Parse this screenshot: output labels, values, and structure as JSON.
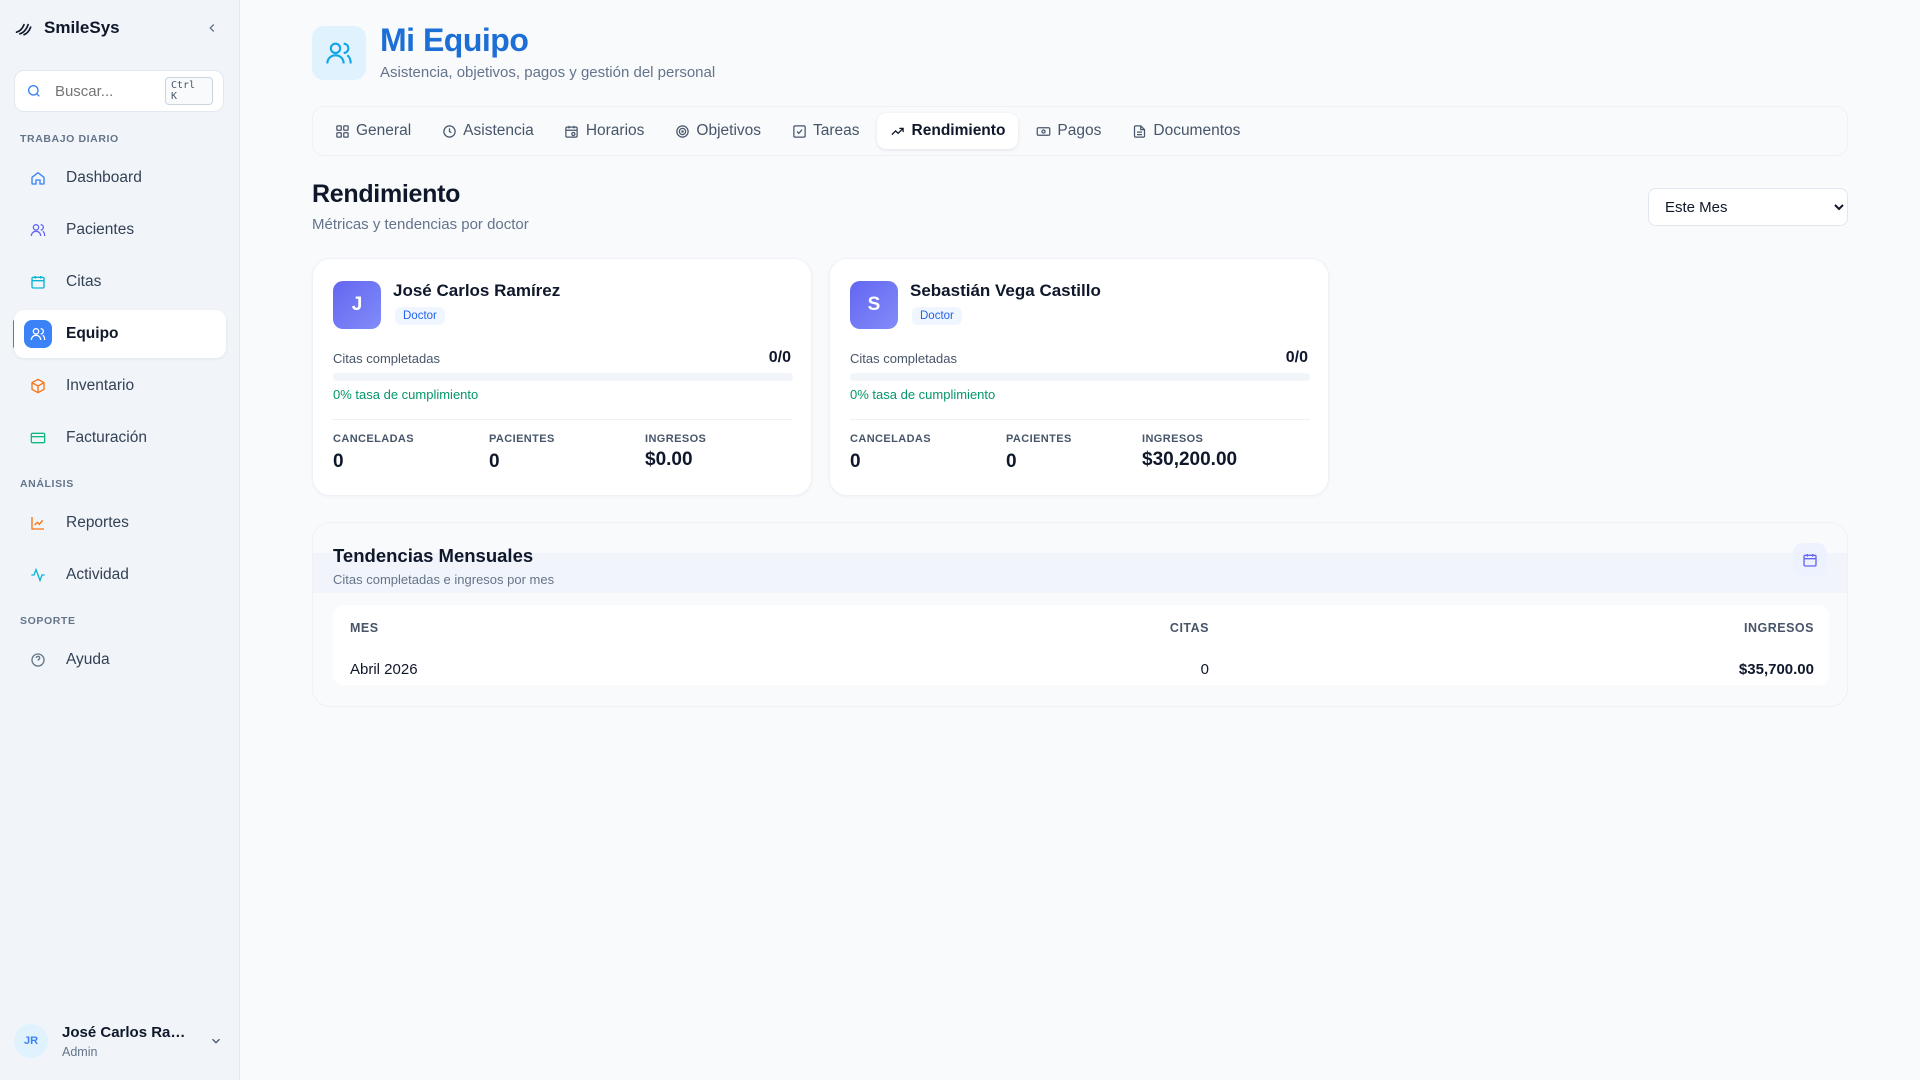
{
  "app": {
    "name": "SmileSys"
  },
  "search": {
    "placeholder": "Buscar...",
    "shortcut": "Ctrl K"
  },
  "sidebar": {
    "sections": [
      {
        "title": "Trabajo diario"
      },
      {
        "title": "Análisis"
      },
      {
        "title": "Soporte"
      }
    ],
    "items": [
      {
        "label": "Dashboard",
        "icon": "home-icon",
        "color": "#3b82f6"
      },
      {
        "label": "Pacientes",
        "icon": "users-icon",
        "color": "#6366f1"
      },
      {
        "label": "Citas",
        "icon": "calendar-icon",
        "color": "#06b6d4"
      },
      {
        "label": "Equipo",
        "icon": "team-icon",
        "color": "#3b82f6",
        "active": true
      },
      {
        "label": "Inventario",
        "icon": "package-icon",
        "color": "#f97316"
      },
      {
        "label": "Facturación",
        "icon": "credit-card-icon",
        "color": "#10b981"
      },
      {
        "label": "Reportes",
        "icon": "chart-line-icon",
        "color": "#f97316"
      },
      {
        "label": "Actividad",
        "icon": "activity-icon",
        "color": "#06b6d4"
      },
      {
        "label": "Ayuda",
        "icon": "help-circle-icon",
        "color": "#64748b"
      }
    ]
  },
  "user": {
    "initials": "JR",
    "name": "José Carlos Ramír...",
    "role": "Admin"
  },
  "header": {
    "title": "Mi Equipo",
    "subtitle": "Asistencia, objetivos, pagos y gestión del personal"
  },
  "tabs": [
    {
      "label": "General",
      "icon": "grid-icon"
    },
    {
      "label": "Asistencia",
      "icon": "clock-icon"
    },
    {
      "label": "Horarios",
      "icon": "calendar-clock-icon"
    },
    {
      "label": "Objetivos",
      "icon": "target-icon"
    },
    {
      "label": "Tareas",
      "icon": "check-square-icon"
    },
    {
      "label": "Rendimiento",
      "icon": "trending-up-icon",
      "active": true
    },
    {
      "label": "Pagos",
      "icon": "banknote-icon"
    },
    {
      "label": "Documentos",
      "icon": "file-text-icon"
    }
  ],
  "performance": {
    "title": "Rendimiento",
    "subtitle": "Métricas y tendencias por doctor",
    "period": {
      "selected": "Este Mes"
    }
  },
  "doctors": [
    {
      "initial": "J",
      "name": "José Carlos Ramírez",
      "role": "Doctor",
      "completed_label": "Citas completadas",
      "completed": "0/0",
      "completion_fraction": 0,
      "rate": "0% tasa de cumplimiento",
      "canceled_label": "Canceladas",
      "canceled": "0",
      "patients_label": "Pacientes",
      "patients": "0",
      "revenue_label": "Ingresos",
      "revenue": "$0.00"
    },
    {
      "initial": "S",
      "name": "Sebastián Vega Castillo",
      "role": "Doctor",
      "completed_label": "Citas completadas",
      "completed": "0/0",
      "completion_fraction": 0,
      "rate": "0% tasa de cumplimiento",
      "canceled_label": "Canceladas",
      "canceled": "0",
      "patients_label": "Pacientes",
      "patients": "0",
      "revenue_label": "Ingresos",
      "revenue": "$30,200.00"
    }
  ],
  "trends": {
    "title": "Tendencias Mensuales",
    "subtitle": "Citas completadas e ingresos por mes",
    "columns": [
      "Mes",
      "Citas",
      "Ingresos"
    ],
    "rows": [
      {
        "month": "Abril 2026",
        "appointments": "0",
        "revenue": "$35,700.00"
      }
    ]
  },
  "colors": {
    "accent": "#3b82f6",
    "title_blue": "#1d6fd6",
    "success": "#059669"
  }
}
